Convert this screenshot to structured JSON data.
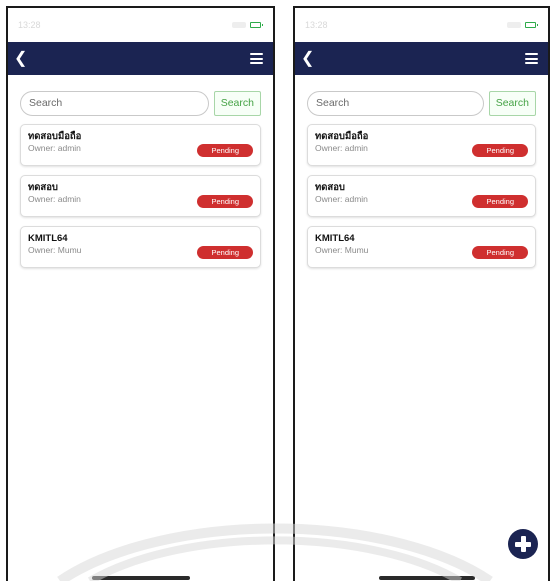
{
  "status_bar": {
    "time": "13:28"
  },
  "search": {
    "placeholder": "Search",
    "button_label": "Search"
  },
  "projects": [
    {
      "title": "ทดสอบมือถือ",
      "owner": "Owner: admin",
      "status": "Pending"
    },
    {
      "title": "ทดสอบ",
      "owner": "Owner: admin",
      "status": "Pending"
    },
    {
      "title": "KMITL64",
      "owner": "Owner: Mumu",
      "status": "Pending"
    }
  ],
  "colors": {
    "navbar": "#1b2452",
    "pending_badge": "#cf2f2f",
    "search_button_text": "#46a346",
    "battery": "#2eaa4a"
  },
  "icons": [
    "back-icon",
    "menu-icon",
    "add-icon",
    "battery-icon"
  ]
}
